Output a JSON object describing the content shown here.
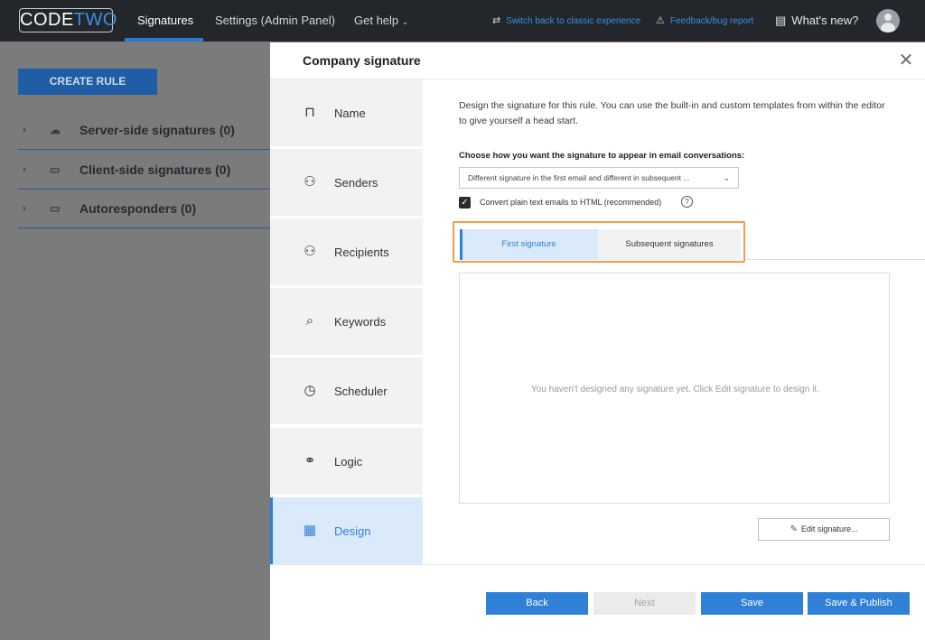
{
  "topbar": {
    "logo_left": "CODE",
    "logo_right": "TWO",
    "nav": [
      "Signatures",
      "Settings (Admin Panel)",
      "Get help"
    ],
    "switch_link": "Switch back to classic experience",
    "feedback_link": "Feedback/bug report",
    "whats_new": "What's new?"
  },
  "background": {
    "create_rule": "CREATE RULE",
    "rows": [
      "Server-side signatures (0)",
      "Client-side signatures (0)",
      "Autoresponders (0)"
    ]
  },
  "modal": {
    "title": "Company signature",
    "steps": [
      {
        "label": "Name",
        "icon": "signpost-icon"
      },
      {
        "label": "Senders",
        "icon": "senders-icon"
      },
      {
        "label": "Recipients",
        "icon": "recipients-icon"
      },
      {
        "label": "Keywords",
        "icon": "keywords-icon"
      },
      {
        "label": "Scheduler",
        "icon": "clock-icon"
      },
      {
        "label": "Logic",
        "icon": "logic-icon"
      },
      {
        "label": "Design",
        "icon": "design-icon"
      }
    ],
    "description": "Design the signature for this rule. You can use the built-in and custom templates from within the editor to give yourself a head start.",
    "choose_label": "Choose how you want the signature to appear in email conversations:",
    "select_value": "Different signature in the first email and different in subsequent ...",
    "checkbox_label": "Convert plain text emails to HTML (recommended)",
    "tabs": [
      "First signature",
      "Subsequent signatures"
    ],
    "empty_text": "You haven't designed any signature yet. Click Edit signature to design it.",
    "edit_button": "Edit signature...",
    "buttons": {
      "back": "Back",
      "next": "Next",
      "save": "Save",
      "publish": "Save & Publish"
    }
  },
  "colors": {
    "accent": "#2f80d7",
    "highlight": "#f39c4a",
    "topbar": "#23272c"
  }
}
